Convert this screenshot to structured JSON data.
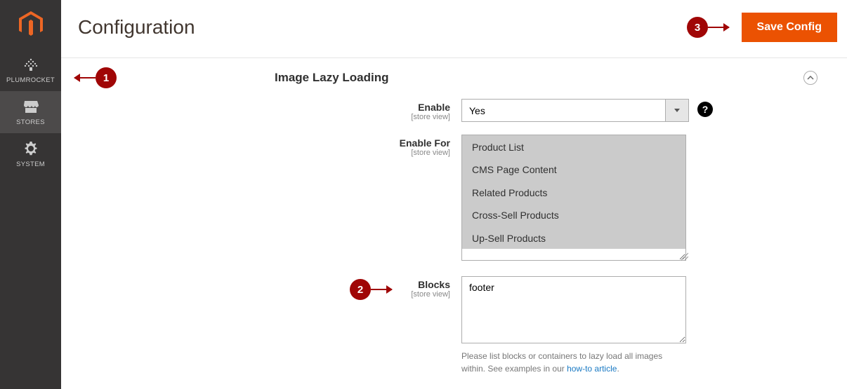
{
  "sidebar": {
    "items": [
      {
        "label": "PLUMROCKET"
      },
      {
        "label": "STORES"
      },
      {
        "label": "SYSTEM"
      }
    ]
  },
  "header": {
    "title": "Configuration",
    "save_label": "Save Config"
  },
  "section": {
    "title": "Image Lazy Loading"
  },
  "fields": {
    "enable": {
      "label": "Enable",
      "scope": "[store view]",
      "value": "Yes"
    },
    "enable_for": {
      "label": "Enable For",
      "scope": "[store view]",
      "options": [
        "Product List",
        "CMS Page Content",
        "Related Products",
        "Cross-Sell Products",
        "Up-Sell Products"
      ]
    },
    "blocks": {
      "label": "Blocks",
      "scope": "[store view]",
      "value": "footer",
      "note_prefix": "Please list blocks or containers to lazy load all images within. See examples in our ",
      "note_link": "how-to article",
      "note_suffix": "."
    }
  },
  "callouts": {
    "c1": "1",
    "c2": "2",
    "c3": "3"
  }
}
